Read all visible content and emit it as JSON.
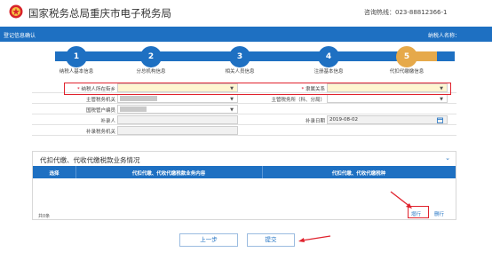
{
  "header": {
    "site_title": "国家税务总局重庆市电子税务局",
    "hotline": "咨询热线：023-88812366-1"
  },
  "bluebar": {
    "left": "登记信息确认",
    "right": "纳税人名称："
  },
  "steps": [
    {
      "num": "1",
      "label": "纳税人基本信息"
    },
    {
      "num": "2",
      "label": "分总机构信息"
    },
    {
      "num": "3",
      "label": "相关人员信息"
    },
    {
      "num": "4",
      "label": "注册基本信息"
    },
    {
      "num": "5",
      "label": "代扣代缴缴信息"
    }
  ],
  "form": {
    "taxpayer_location_label": "纳税人所在街乡",
    "affiliation_label": "隶属关系",
    "tax_authority_label": "主管税务机关",
    "tax_office_label": "主管税务所（科、分局）",
    "state_tax_manager_label": "国税管户编员",
    "registrant_label": "补录人",
    "registration_date_label": "补录日期",
    "registration_date_value": "2019-08-02",
    "registration_authority_label": "补录税务机关"
  },
  "section": {
    "title": "代扣代缴、代收代缴税款业务情况",
    "col_select": "选择",
    "col_content": "代扣代缴、代收代缴税款业务内容",
    "col_tax_type": "代扣代缴、代收代缴税种",
    "total": "共0条",
    "add_row": "增行",
    "delete_row": "删行"
  },
  "buttons": {
    "prev": "上一步",
    "submit": "提交"
  },
  "colors": {
    "primary_blue": "#1e70c2",
    "active_step": "#e6a94a",
    "highlight_red": "#e0222d"
  }
}
